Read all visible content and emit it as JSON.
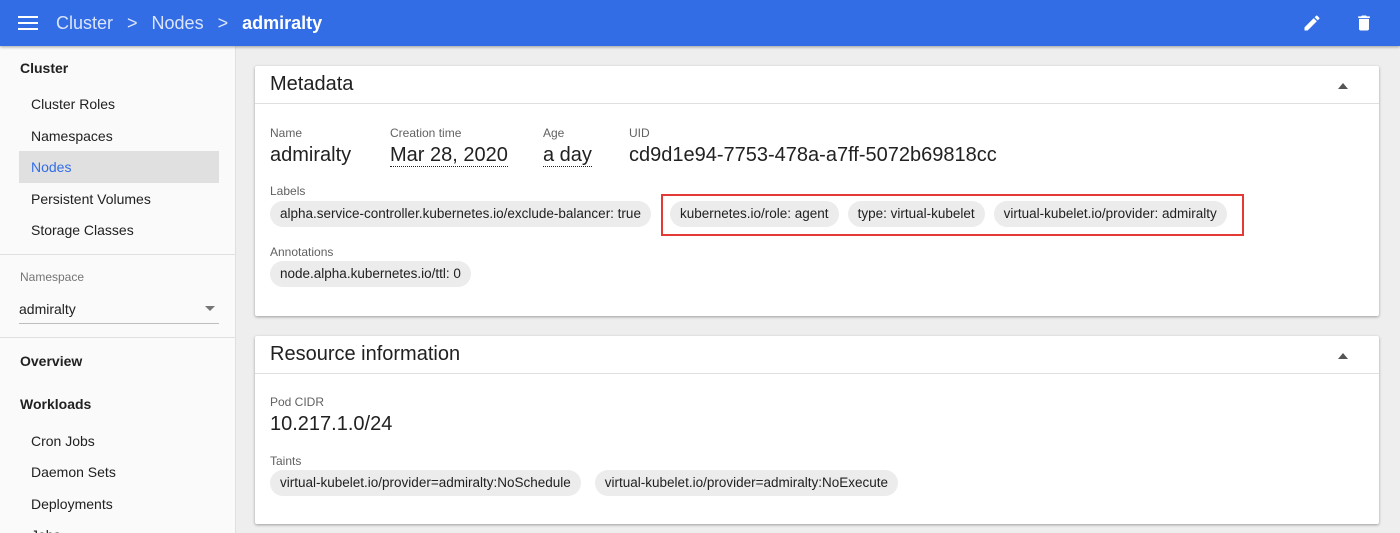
{
  "header": {
    "breadcrumb": [
      "Cluster",
      "Nodes"
    ],
    "current": "admiralty",
    "separator": ">",
    "accent_color": "#326de6"
  },
  "sidebar": {
    "cluster_heading": "Cluster",
    "cluster_items": [
      "Cluster Roles",
      "Namespaces",
      "Nodes",
      "Persistent Volumes",
      "Storage Classes"
    ],
    "active_item": "Nodes",
    "namespace_label": "Namespace",
    "namespace_value": "admiralty",
    "overview": "Overview",
    "workloads_heading": "Workloads",
    "workload_items": [
      "Cron Jobs",
      "Daemon Sets",
      "Deployments",
      "Jobs"
    ]
  },
  "metadata": {
    "title": "Metadata",
    "name_label": "Name",
    "name_value": "admiralty",
    "creation_label": "Creation time",
    "creation_value": "Mar 28, 2020",
    "age_label": "Age",
    "age_value": "a day",
    "uid_label": "UID",
    "uid_value": "cd9d1e94-7753-478a-a7ff-5072b69818cc",
    "labels_label": "Labels",
    "labels": [
      "alpha.service-controller.kubernetes.io/exclude-balancer: true",
      "kubernetes.io/role: agent",
      "type: virtual-kubelet",
      "virtual-kubelet.io/provider: admiralty"
    ],
    "annotations_label": "Annotations",
    "annotations": [
      "node.alpha.kubernetes.io/ttl: 0"
    ]
  },
  "resource": {
    "title": "Resource information",
    "pod_cidr_label": "Pod CIDR",
    "pod_cidr_value": "10.217.1.0/24",
    "taints_label": "Taints",
    "taints": [
      "virtual-kubelet.io/provider=admiralty:NoSchedule",
      "virtual-kubelet.io/provider=admiralty:NoExecute"
    ]
  },
  "icons": [
    "menu-icon",
    "edit-icon",
    "delete-icon",
    "chevron-down-icon",
    "collapse-icon"
  ],
  "highlight_color": "#e53935"
}
